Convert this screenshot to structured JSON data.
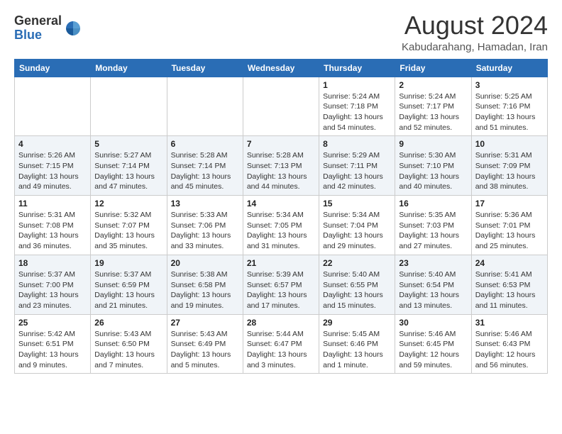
{
  "header": {
    "logo_general": "General",
    "logo_blue": "Blue",
    "month_year": "August 2024",
    "location": "Kabudarahang, Hamadan, Iran"
  },
  "weekdays": [
    "Sunday",
    "Monday",
    "Tuesday",
    "Wednesday",
    "Thursday",
    "Friday",
    "Saturday"
  ],
  "weeks": [
    [
      {
        "day": "",
        "info": ""
      },
      {
        "day": "",
        "info": ""
      },
      {
        "day": "",
        "info": ""
      },
      {
        "day": "",
        "info": ""
      },
      {
        "day": "1",
        "info": "Sunrise: 5:24 AM\nSunset: 7:18 PM\nDaylight: 13 hours\nand 54 minutes."
      },
      {
        "day": "2",
        "info": "Sunrise: 5:24 AM\nSunset: 7:17 PM\nDaylight: 13 hours\nand 52 minutes."
      },
      {
        "day": "3",
        "info": "Sunrise: 5:25 AM\nSunset: 7:16 PM\nDaylight: 13 hours\nand 51 minutes."
      }
    ],
    [
      {
        "day": "4",
        "info": "Sunrise: 5:26 AM\nSunset: 7:15 PM\nDaylight: 13 hours\nand 49 minutes."
      },
      {
        "day": "5",
        "info": "Sunrise: 5:27 AM\nSunset: 7:14 PM\nDaylight: 13 hours\nand 47 minutes."
      },
      {
        "day": "6",
        "info": "Sunrise: 5:28 AM\nSunset: 7:14 PM\nDaylight: 13 hours\nand 45 minutes."
      },
      {
        "day": "7",
        "info": "Sunrise: 5:28 AM\nSunset: 7:13 PM\nDaylight: 13 hours\nand 44 minutes."
      },
      {
        "day": "8",
        "info": "Sunrise: 5:29 AM\nSunset: 7:11 PM\nDaylight: 13 hours\nand 42 minutes."
      },
      {
        "day": "9",
        "info": "Sunrise: 5:30 AM\nSunset: 7:10 PM\nDaylight: 13 hours\nand 40 minutes."
      },
      {
        "day": "10",
        "info": "Sunrise: 5:31 AM\nSunset: 7:09 PM\nDaylight: 13 hours\nand 38 minutes."
      }
    ],
    [
      {
        "day": "11",
        "info": "Sunrise: 5:31 AM\nSunset: 7:08 PM\nDaylight: 13 hours\nand 36 minutes."
      },
      {
        "day": "12",
        "info": "Sunrise: 5:32 AM\nSunset: 7:07 PM\nDaylight: 13 hours\nand 35 minutes."
      },
      {
        "day": "13",
        "info": "Sunrise: 5:33 AM\nSunset: 7:06 PM\nDaylight: 13 hours\nand 33 minutes."
      },
      {
        "day": "14",
        "info": "Sunrise: 5:34 AM\nSunset: 7:05 PM\nDaylight: 13 hours\nand 31 minutes."
      },
      {
        "day": "15",
        "info": "Sunrise: 5:34 AM\nSunset: 7:04 PM\nDaylight: 13 hours\nand 29 minutes."
      },
      {
        "day": "16",
        "info": "Sunrise: 5:35 AM\nSunset: 7:03 PM\nDaylight: 13 hours\nand 27 minutes."
      },
      {
        "day": "17",
        "info": "Sunrise: 5:36 AM\nSunset: 7:01 PM\nDaylight: 13 hours\nand 25 minutes."
      }
    ],
    [
      {
        "day": "18",
        "info": "Sunrise: 5:37 AM\nSunset: 7:00 PM\nDaylight: 13 hours\nand 23 minutes."
      },
      {
        "day": "19",
        "info": "Sunrise: 5:37 AM\nSunset: 6:59 PM\nDaylight: 13 hours\nand 21 minutes."
      },
      {
        "day": "20",
        "info": "Sunrise: 5:38 AM\nSunset: 6:58 PM\nDaylight: 13 hours\nand 19 minutes."
      },
      {
        "day": "21",
        "info": "Sunrise: 5:39 AM\nSunset: 6:57 PM\nDaylight: 13 hours\nand 17 minutes."
      },
      {
        "day": "22",
        "info": "Sunrise: 5:40 AM\nSunset: 6:55 PM\nDaylight: 13 hours\nand 15 minutes."
      },
      {
        "day": "23",
        "info": "Sunrise: 5:40 AM\nSunset: 6:54 PM\nDaylight: 13 hours\nand 13 minutes."
      },
      {
        "day": "24",
        "info": "Sunrise: 5:41 AM\nSunset: 6:53 PM\nDaylight: 13 hours\nand 11 minutes."
      }
    ],
    [
      {
        "day": "25",
        "info": "Sunrise: 5:42 AM\nSunset: 6:51 PM\nDaylight: 13 hours\nand 9 minutes."
      },
      {
        "day": "26",
        "info": "Sunrise: 5:43 AM\nSunset: 6:50 PM\nDaylight: 13 hours\nand 7 minutes."
      },
      {
        "day": "27",
        "info": "Sunrise: 5:43 AM\nSunset: 6:49 PM\nDaylight: 13 hours\nand 5 minutes."
      },
      {
        "day": "28",
        "info": "Sunrise: 5:44 AM\nSunset: 6:47 PM\nDaylight: 13 hours\nand 3 minutes."
      },
      {
        "day": "29",
        "info": "Sunrise: 5:45 AM\nSunset: 6:46 PM\nDaylight: 13 hours\nand 1 minute."
      },
      {
        "day": "30",
        "info": "Sunrise: 5:46 AM\nSunset: 6:45 PM\nDaylight: 12 hours\nand 59 minutes."
      },
      {
        "day": "31",
        "info": "Sunrise: 5:46 AM\nSunset: 6:43 PM\nDaylight: 12 hours\nand 56 minutes."
      }
    ]
  ]
}
